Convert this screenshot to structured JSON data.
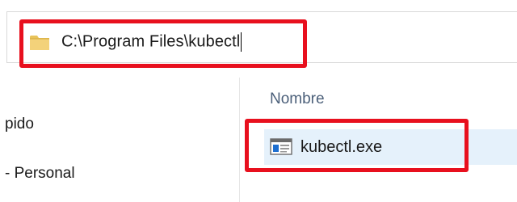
{
  "address_bar": {
    "path": "C:\\Program Files\\kubectl",
    "folder_icon": "folder-icon"
  },
  "navigation": {
    "items": [
      {
        "label": "pido"
      },
      {
        "label": "- Personal"
      }
    ]
  },
  "file_list": {
    "column_header": "Nombre",
    "files": [
      {
        "name": "kubectl.exe",
        "icon": "exe-file-icon",
        "selected": true
      }
    ]
  },
  "colors": {
    "highlight": "#e8101e",
    "selection": "#e5f1fb",
    "header_text": "#4c607a"
  }
}
